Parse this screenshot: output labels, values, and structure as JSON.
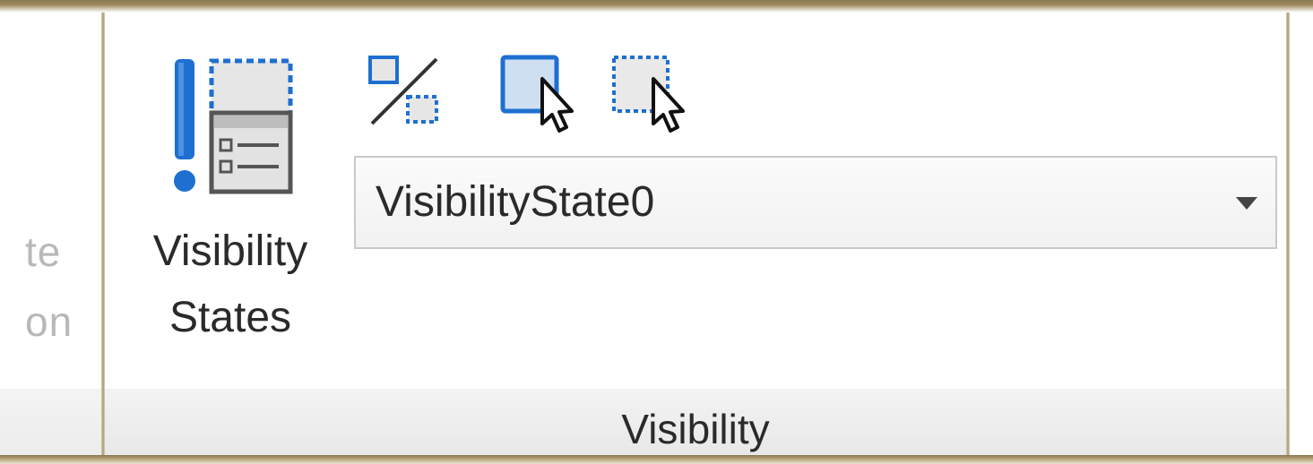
{
  "previous_panel": {
    "partial_label_line1": "te",
    "partial_label_line2": "on"
  },
  "visibility_panel": {
    "title": "Visibility",
    "visibility_states_button": {
      "label_line1": "Visibility",
      "label_line2": "States",
      "icon": "visibility-states-icon"
    },
    "small_buttons": [
      {
        "icon": "make-visible-invisible-icon"
      },
      {
        "icon": "show-all-objects-icon"
      },
      {
        "icon": "hide-objects-icon"
      }
    ],
    "state_dropdown": {
      "value": "VisibilityState0",
      "icon": "dropdown-arrow-icon"
    }
  },
  "colors": {
    "accent_blue": "#1e6fd0",
    "border_gold": "#8a7a52"
  }
}
